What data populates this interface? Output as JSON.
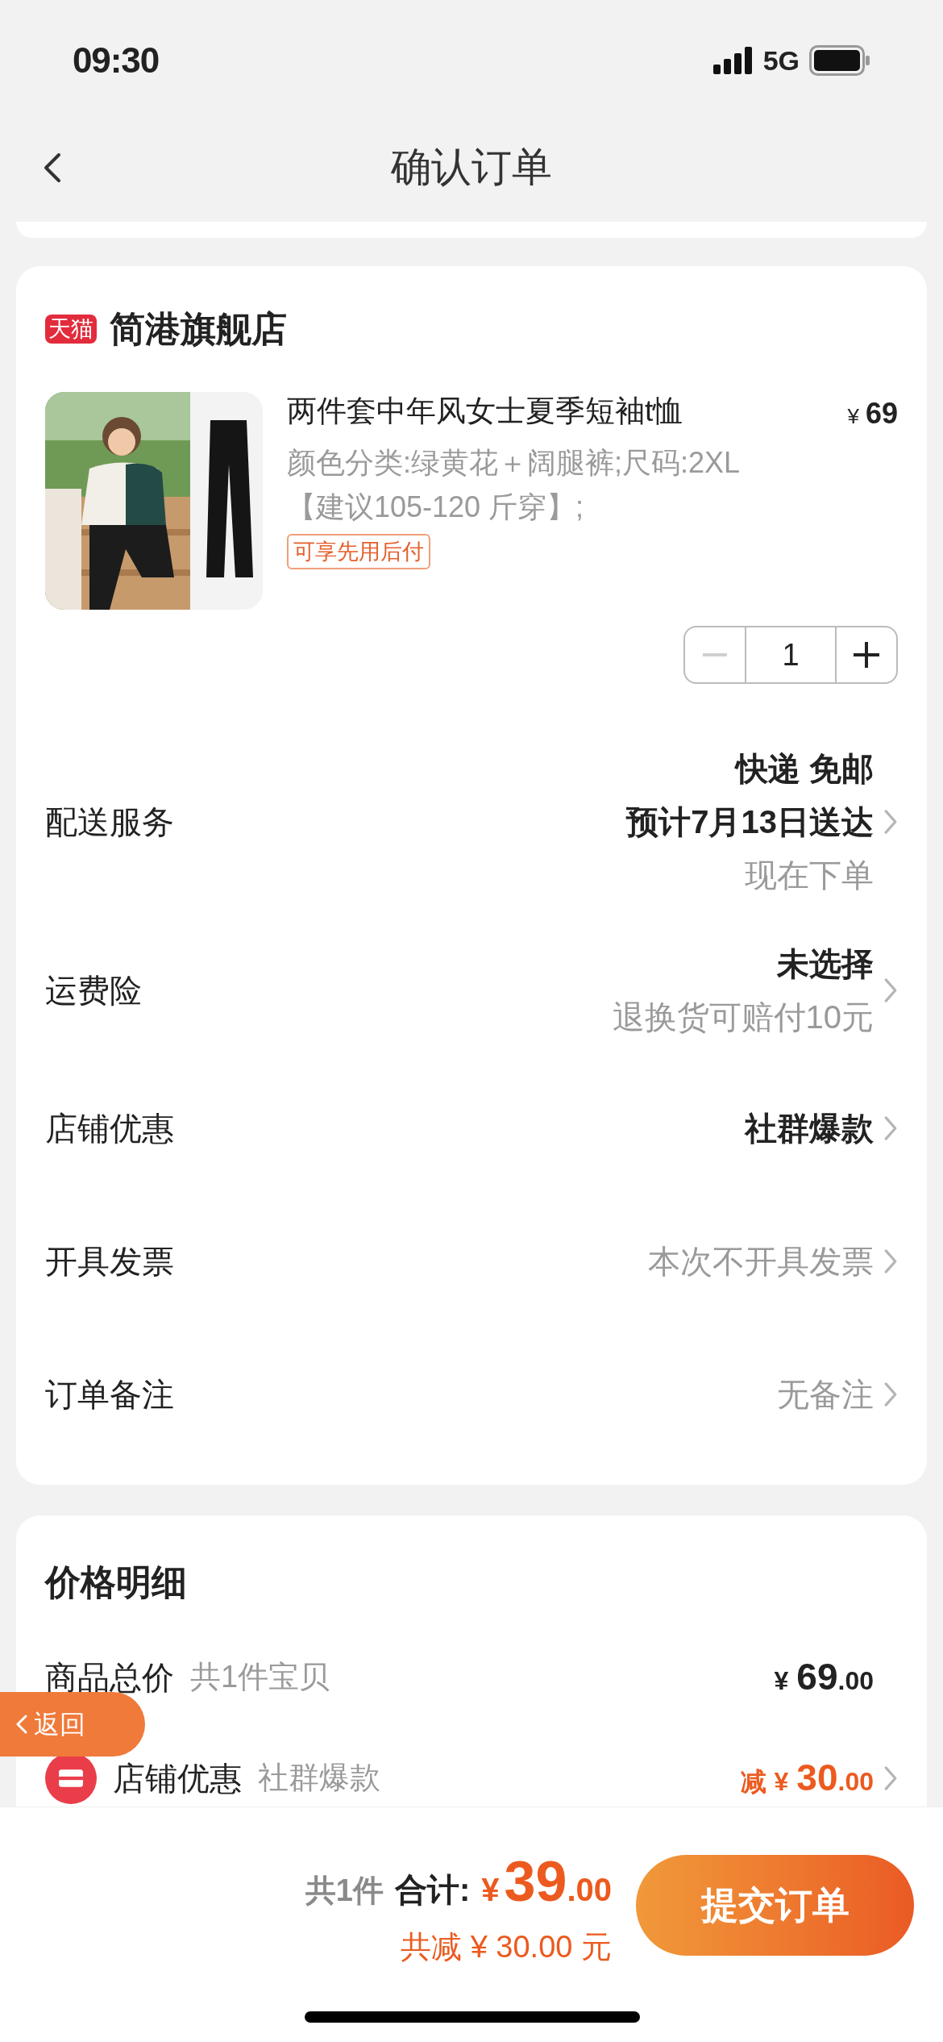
{
  "status_bar": {
    "time": "09:30",
    "network": "5G"
  },
  "nav": {
    "title": "确认订单"
  },
  "store": {
    "logo_text": "天猫",
    "name": "简港旗舰店",
    "product": {
      "kind": "picture",
      "title": "两件套中年风女士夏季短袖t恤",
      "currency": "¥",
      "price": "69",
      "spec": "颜色分类:绿黄花＋阔腿裤;尺码:2XL【建议105-120 斤穿】;",
      "tag": "可享先用后付",
      "quantity": "1",
      "minus_disabled": true
    },
    "rows": [
      {
        "label": "配送服务",
        "values": [
          {
            "text": "快递 免邮",
            "kind": "strong"
          },
          {
            "text": "预计7月13日送达",
            "kind": "strong"
          },
          {
            "text": "现在下单",
            "kind": "muted"
          }
        ]
      },
      {
        "label": "运费险",
        "values": [
          {
            "text": "未选择",
            "kind": "strong"
          },
          {
            "text": "退换货可赔付10元",
            "kind": "muted"
          }
        ]
      },
      {
        "label": "店铺优惠",
        "values": [
          {
            "text": "社群爆款",
            "kind": "strong"
          }
        ]
      },
      {
        "label": "开具发票",
        "values": [
          {
            "text": "本次不开具发票",
            "kind": "muted"
          }
        ]
      },
      {
        "label": "订单备注",
        "values": [
          {
            "text": "无备注",
            "kind": "muted"
          }
        ]
      }
    ]
  },
  "price_detail": {
    "title": "价格明细",
    "rows": [
      {
        "kind": "total",
        "label": "商品总价",
        "note": "共1件宝贝",
        "currency": "¥",
        "integer": "69",
        "decimal": ".00"
      },
      {
        "kind": "discount",
        "label": "店铺优惠",
        "note": "社群爆款",
        "prefix": "减",
        "currency": "¥",
        "integer": "30",
        "decimal": ".00"
      }
    ]
  },
  "floating_back": {
    "label": "返回"
  },
  "bottom_bar": {
    "count": "共1件",
    "total_label": "合计:",
    "currency": "¥",
    "integer": "39",
    "decimal": ".00",
    "saved": "共减 ¥ 30.00 元",
    "submit": "提交订单"
  }
}
